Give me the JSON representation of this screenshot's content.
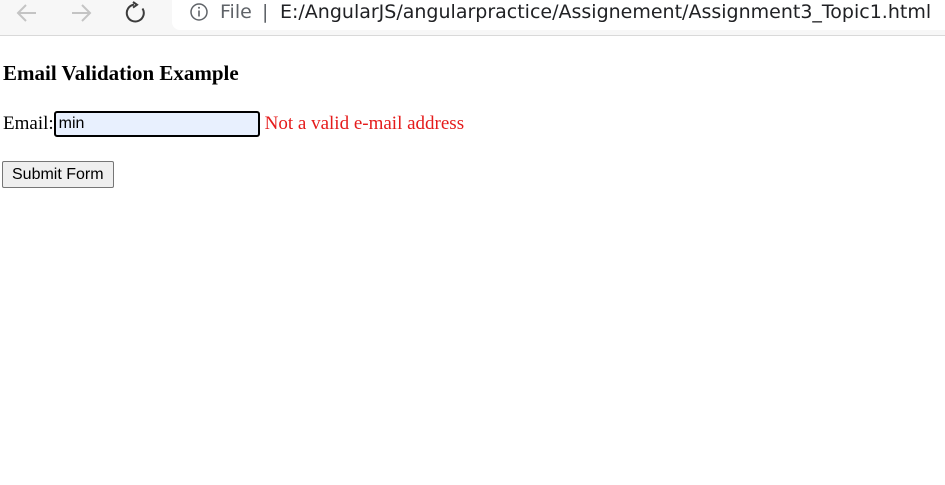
{
  "browser": {
    "scheme_label": "File",
    "separator": "|",
    "url": "E:/AngularJS/angularpractice/Assignement/Assignment3_Topic1.html",
    "icons": {
      "back": "arrow-left-icon",
      "forward": "arrow-right-icon",
      "reload": "reload-icon",
      "info": "info-icon"
    }
  },
  "page": {
    "title": "Email Validation Example",
    "email_label": "Email:",
    "email_value": "min",
    "error_message": "Not a valid e-mail address",
    "submit_label": "Submit Form"
  },
  "colors": {
    "error": "#e51b1b",
    "input_autofill_bg": "#e8f0fe"
  }
}
